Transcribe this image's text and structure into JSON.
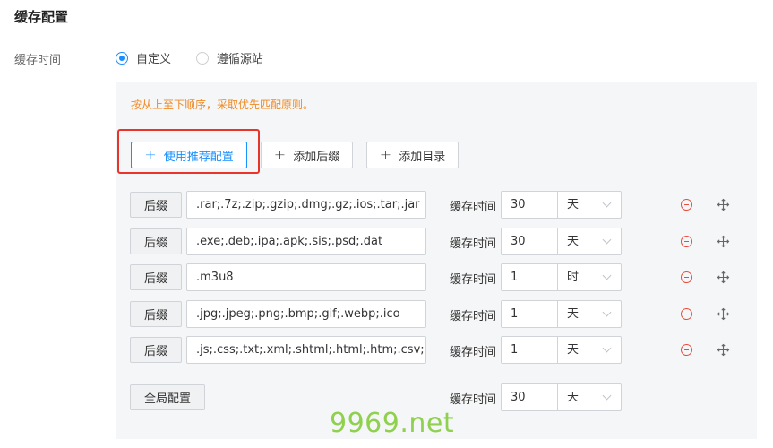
{
  "section_title": "缓存配置",
  "cache_time_label": "缓存时间",
  "mode": {
    "options": [
      {
        "label": "自定义",
        "checked": true
      },
      {
        "label": "遵循源站",
        "checked": false
      }
    ]
  },
  "tip": "按从上至下顺序，采取优先匹配原则。",
  "toolbar": {
    "recommend_label": "使用推荐配置",
    "add_suffix_label": "添加后缀",
    "add_dir_label": "添加目录"
  },
  "rules": [
    {
      "type": "后缀",
      "pattern": ".rar;.7z;.zip;.gzip;.dmg;.gz;.ios;.tar;.jar",
      "cache_label": "缓存时间",
      "value": "30",
      "unit": "天"
    },
    {
      "type": "后缀",
      "pattern": ".exe;.deb;.ipa;.apk;.sis;.psd;.dat",
      "cache_label": "缓存时间",
      "value": "30",
      "unit": "天"
    },
    {
      "type": "后缀",
      "pattern": ".m3u8",
      "cache_label": "缓存时间",
      "value": "1",
      "unit": "时"
    },
    {
      "type": "后缀",
      "pattern": ".jpg;.jpeg;.png;.bmp;.gif;.webp;.ico",
      "cache_label": "缓存时间",
      "value": "1",
      "unit": "天"
    },
    {
      "type": "后缀",
      "pattern": ".js;.css;.txt;.xml;.shtml;.html;.htm;.csv;.bat",
      "cache_label": "缓存时间",
      "value": "1",
      "unit": "天"
    }
  ],
  "global": {
    "label": "全局配置",
    "cache_label": "缓存时间",
    "value": "30",
    "unit": "天"
  },
  "watermark": "9969.net",
  "colors": {
    "accent": "#1890ff",
    "tip": "#f08a24",
    "danger": "#e84c3d",
    "highlight": "#e8352c",
    "watermark": "#8fd14f"
  },
  "icons": [
    "plus-icon",
    "remove-circle-icon",
    "move-icon",
    "chevron-down-icon"
  ]
}
